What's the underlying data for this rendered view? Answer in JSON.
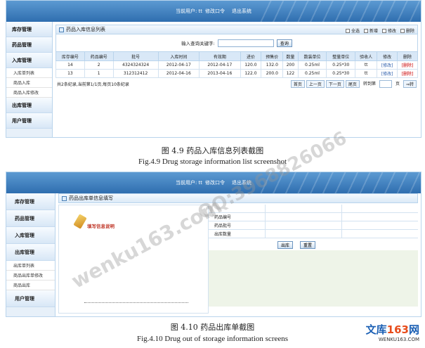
{
  "figure1": {
    "topbar": {
      "user_label": "当前用户: tt",
      "change_pwd": "修改口令",
      "logout": "退出系统"
    },
    "sidebar": {
      "groups": [
        {
          "label": "库存管理"
        },
        {
          "label": "药品管理"
        },
        {
          "label": "入库管理"
        }
      ],
      "sub_items": [
        "入库单列表",
        "商品入库",
        "商品入库修改"
      ],
      "lower_groups": [
        {
          "label": "出库管理"
        },
        {
          "label": "用户管理"
        }
      ]
    },
    "panel_title": "药品入库信息列表",
    "toolbar": {
      "select_all": "全选",
      "add": "新增",
      "edit": "修改",
      "delete": "删除"
    },
    "search": {
      "label": "输入查询关键字:",
      "value": "",
      "button": "查询"
    },
    "table": {
      "headers": [
        "库存编号",
        "药品编号",
        "批号",
        "入库时间",
        "有效期",
        "进价",
        "预售价",
        "数量",
        "数装单位",
        "整量单位",
        "验收人",
        "修改",
        "删除"
      ],
      "rows": [
        [
          "14",
          "2",
          "4324324324",
          "2012-04-17",
          "2012-04-17",
          "120.0",
          "132.0",
          "200",
          "0.25ml",
          "0.25*30",
          "tt",
          "[修改]",
          "[删除]"
        ],
        [
          "13",
          "1",
          "312312412",
          "2012-04-16",
          "2013-04-16",
          "122.0",
          "200.0",
          "122",
          "0.25ml",
          "0.25*30",
          "tt",
          "[修改]",
          "[删除]"
        ]
      ]
    },
    "pager": {
      "summary": "共2条纪录,当前第1/1页,每页10条纪录",
      "first": "首页",
      "prev": "上一页",
      "next": "下一页",
      "last": "尾页",
      "goto": "转到第",
      "goto_suffix": "页",
      "go": "⇒转"
    },
    "caption_cn": "图 4.9  药品入库信息列表截图",
    "caption_en": "Fig.4.9    Drug storage information list screenshot"
  },
  "figure2": {
    "topbar": {
      "user_label": "当前用户: tt",
      "change_pwd": "修改口令",
      "logout": "退出系统"
    },
    "sidebar": {
      "groups": [
        {
          "label": "库存管理"
        },
        {
          "label": "药品管理"
        },
        {
          "label": "入库管理"
        },
        {
          "label": "出库管理"
        }
      ],
      "sub_items": [
        "出库单列表",
        "商品出库单修改",
        "商品出库"
      ],
      "lower_groups": [
        {
          "label": "用户管理"
        }
      ]
    },
    "panel_title": "药品出库单信息填写",
    "note_title": "填写信息说明",
    "form": {
      "fields": [
        "药品编号",
        "药品批号",
        "出库数量"
      ],
      "submit": "出库",
      "reset": "重置"
    },
    "caption_cn": "图 4.10  药品出库单截图",
    "caption_en": "Fig.4.10    Drug out of storage information screens"
  },
  "watermark": {
    "text1": "wenku163.com",
    "text2": "QQ:3968826066"
  },
  "logo": {
    "brand": "文库",
    "num": "163",
    "suffix": "网",
    "url": "WENKU163.COM"
  }
}
